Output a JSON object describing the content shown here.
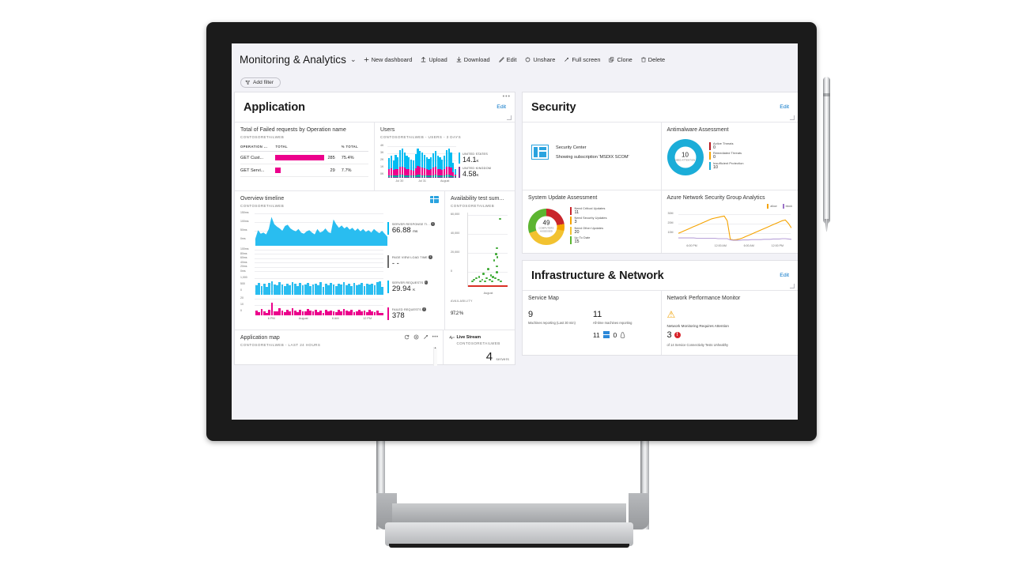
{
  "toolbar": {
    "dashboard_title": "Monitoring & Analytics",
    "chevron": "⌄",
    "commands": [
      {
        "label": "New dashboard",
        "icon": "plus-icon"
      },
      {
        "label": "Upload",
        "icon": "upload-icon"
      },
      {
        "label": "Download",
        "icon": "download-icon"
      },
      {
        "label": "Edit",
        "icon": "pencil-icon"
      },
      {
        "label": "Unshare",
        "icon": "unshare-icon"
      },
      {
        "label": "Full screen",
        "icon": "fullscreen-icon"
      },
      {
        "label": "Clone",
        "icon": "clone-icon"
      },
      {
        "label": "Delete",
        "icon": "trash-icon"
      }
    ],
    "add_filter": "Add filter"
  },
  "panels": {
    "application": {
      "title": "Application",
      "edit": "Edit"
    },
    "security": {
      "title": "Security",
      "edit": "Edit"
    },
    "infrastructure": {
      "title": "Infrastructure & Network",
      "edit": "Edit"
    }
  },
  "failed_requests": {
    "title": "Total of Failed requests by Operation name",
    "subtitle": "CONTOSORETAILWEB",
    "columns": [
      "OPERATION ...",
      "TOTAL",
      "% TOTAL"
    ],
    "rows": [
      {
        "operation": "GET Cust...",
        "total": "285",
        "pct": "75.4%",
        "bar": 100
      },
      {
        "operation": "GET Servi...",
        "total": "29",
        "pct": "7.7%",
        "bar": 10
      }
    ]
  },
  "users": {
    "title": "Users",
    "subtitle": "CONTOSORETAILWEB - USERS - 3 DAYS",
    "y_ticks": [
      "4K",
      "3K",
      "2K",
      "1K",
      "0K"
    ],
    "x_ticks": [
      "Jul 30",
      "Jul 31",
      "August"
    ],
    "legend": [
      {
        "name": "UNITED STATES",
        "value": "14.1",
        "unit": "K",
        "color": "#00bcf2"
      },
      {
        "name": "UNITED KINGDOM",
        "value": "4.58",
        "unit": "K",
        "color": "#7a3b9a"
      }
    ],
    "bars": [
      [
        42,
        22,
        6,
        4
      ],
      [
        48,
        26,
        6,
        4
      ],
      [
        36,
        20,
        5,
        4
      ],
      [
        52,
        24,
        6,
        4
      ],
      [
        44,
        22,
        6,
        4
      ],
      [
        62,
        30,
        7,
        4
      ],
      [
        66,
        32,
        7,
        4
      ],
      [
        58,
        28,
        6,
        4
      ],
      [
        48,
        24,
        6,
        4
      ],
      [
        44,
        22,
        6,
        4
      ],
      [
        40,
        20,
        5,
        4
      ],
      [
        38,
        18,
        5,
        4
      ],
      [
        52,
        26,
        6,
        4
      ],
      [
        64,
        34,
        7,
        4
      ],
      [
        60,
        30,
        7,
        4
      ],
      [
        56,
        28,
        6,
        4
      ],
      [
        50,
        26,
        6,
        4
      ],
      [
        46,
        22,
        6,
        4
      ],
      [
        42,
        20,
        5,
        4
      ],
      [
        46,
        22,
        6,
        4
      ],
      [
        54,
        28,
        6,
        4
      ],
      [
        58,
        30,
        7,
        4
      ],
      [
        50,
        24,
        6,
        4
      ],
      [
        44,
        22,
        6,
        4
      ],
      [
        40,
        20,
        5,
        4
      ],
      [
        48,
        24,
        6,
        4
      ],
      [
        62,
        30,
        7,
        4
      ],
      [
        66,
        32,
        7,
        4
      ],
      [
        58,
        28,
        6,
        4
      ],
      [
        36,
        14,
        4,
        3
      ],
      [
        20,
        8,
        3,
        2
      ]
    ]
  },
  "overview_timeline": {
    "title": "Overview timeline",
    "subtitle": "CONTOSORETAILWEB",
    "icon": "chart-grid-icon",
    "chart1_y": [
      "150ms",
      "100ms",
      "50ms",
      "0ms"
    ],
    "chart2_y": [
      "100ms",
      "80ms",
      "60ms",
      "40ms",
      "20ms",
      "0ms"
    ],
    "chart3_y": [
      "1,000",
      "500",
      "0"
    ],
    "chart4_y": [
      "20",
      "10",
      "0"
    ],
    "x_ticks": [
      "6 PM",
      "August",
      "6 AM",
      "12 PM"
    ],
    "metrics": [
      {
        "name": "SERVER RESPONSE TI...",
        "value": "66.88",
        "unit": "ms",
        "color": "#00bcf2"
      },
      {
        "name": "PAGE VIEW LOAD TIME",
        "value": "- -",
        "unit": "",
        "color": "#6b6b6b"
      },
      {
        "name": "SERVER REQUESTS",
        "value": "29.94",
        "unit": "K",
        "color": "#00bcf2"
      },
      {
        "name": "FAILED REQUESTS",
        "value": "378",
        "unit": "",
        "color": "#ec008c"
      }
    ],
    "area_points": [
      24,
      52,
      40,
      44,
      38,
      56,
      96,
      72,
      64,
      58,
      50,
      66,
      70,
      58,
      52,
      48,
      56,
      44,
      40,
      48,
      52,
      44,
      38,
      56,
      44,
      48,
      58,
      46,
      42,
      88,
      72,
      60,
      68,
      58,
      64,
      54,
      60,
      50,
      58,
      48,
      56,
      46,
      52,
      44,
      56,
      48,
      42,
      50,
      40,
      30
    ],
    "req_bars": [
      52,
      64,
      48,
      58,
      44,
      62,
      70,
      56,
      50,
      66,
      54,
      48,
      60,
      52,
      68,
      58,
      46,
      62,
      50,
      56,
      64,
      48,
      54,
      60,
      52,
      66,
      44,
      58,
      50,
      62,
      56,
      48,
      60,
      54,
      66,
      52,
      58,
      46,
      62,
      50,
      56,
      64,
      48,
      60,
      54,
      58,
      52,
      66,
      70,
      44
    ],
    "fail_bars": [
      30,
      22,
      40,
      26,
      18,
      34,
      82,
      28,
      24,
      46,
      30,
      22,
      38,
      26,
      44,
      30,
      20,
      36,
      28,
      24,
      40,
      32,
      26,
      34,
      22,
      30,
      18,
      38,
      26,
      32,
      28,
      20,
      36,
      24,
      42,
      30,
      26,
      34,
      22,
      28,
      36,
      24,
      30,
      20,
      34,
      26,
      22,
      30,
      18,
      14
    ]
  },
  "availability": {
    "title": "Availability test sum...",
    "subtitle": "CONTOSORETAILWEB",
    "y_ticks": [
      "60,000",
      "40,000",
      "20,000",
      "0"
    ],
    "x_tick": "August",
    "kpi_label": "AVAILABILITY",
    "kpi_value": "97.2",
    "kpi_unit": "%",
    "scatter": [
      {
        "x": 78,
        "y": 7
      },
      {
        "x": 70,
        "y": 46
      },
      {
        "x": 71,
        "y": 58
      },
      {
        "x": 68,
        "y": 54
      },
      {
        "x": 63,
        "y": 62
      },
      {
        "x": 70,
        "y": 70
      },
      {
        "x": 48,
        "y": 74
      },
      {
        "x": 70,
        "y": 78
      },
      {
        "x": 36,
        "y": 80
      },
      {
        "x": 55,
        "y": 82
      },
      {
        "x": 60,
        "y": 84
      },
      {
        "x": 25,
        "y": 84
      },
      {
        "x": 44,
        "y": 86
      },
      {
        "x": 18,
        "y": 86
      },
      {
        "x": 33,
        "y": 88
      },
      {
        "x": 52,
        "y": 88
      },
      {
        "x": 66,
        "y": 86
      },
      {
        "x": 74,
        "y": 88
      },
      {
        "x": 12,
        "y": 88
      },
      {
        "x": 28,
        "y": 90
      },
      {
        "x": 40,
        "y": 90
      },
      {
        "x": 58,
        "y": 90
      },
      {
        "x": 80,
        "y": 90
      },
      {
        "x": 8,
        "y": 90
      }
    ]
  },
  "application_map": {
    "title": "Application map",
    "subtitle": "CONTOSORETAILWEB - LAST 24 HOURS",
    "icons": [
      "refresh-icon",
      "target-icon",
      "expand-icon",
      "more-icon"
    ]
  },
  "live_stream": {
    "title": "Live Stream",
    "subtitle": "CONTOSORETAILWEB",
    "value": "4",
    "unit": "servers",
    "icon": "pulse-icon"
  },
  "security_center": {
    "name": "Security Center",
    "subscription": "Showing subscription 'MSDIX SCOM'",
    "icon": "security-center-icon"
  },
  "antimalware": {
    "title": "Antimalware Assessment",
    "center_value": "10",
    "center_label": "NEED ATTENTION",
    "donut_color": "#1badd8",
    "legend": [
      {
        "name": "Active Threats",
        "value": "0",
        "color": "#b81b21"
      },
      {
        "name": "Remediated Threats",
        "value": "0",
        "color": "#f5a300"
      },
      {
        "name": "Insufficient Protection",
        "value": "10",
        "color": "#1badd8"
      }
    ]
  },
  "system_update": {
    "title": "System Update Assessment",
    "center_value": "49",
    "center_label": "COMPUTERS ASSESSED",
    "legend": [
      {
        "name": "Need Critical Updates",
        "value": "11",
        "color": "#c9252b"
      },
      {
        "name": "Need Security Updates",
        "value": "3",
        "color": "#f5a300"
      },
      {
        "name": "Need Other Updates",
        "value": "20",
        "color": "#f2c230"
      },
      {
        "name": "Up To Date",
        "value": "15",
        "color": "#5cb531"
      }
    ]
  },
  "nsg_analytics": {
    "title": "Azure Network Security Group Analytics",
    "legend": [
      {
        "name": "allow",
        "color": "#f5a300"
      },
      {
        "name": "block",
        "color": "#9b72c7"
      }
    ],
    "y_ticks": [
      "30M",
      "20M",
      "10M"
    ],
    "x_ticks": [
      "6:00 PM",
      "12:00 AM",
      "6:00 AM",
      "12:00 PM"
    ],
    "allow_series": [
      28,
      32,
      36,
      40,
      44,
      48,
      52,
      56,
      60,
      64,
      68,
      72,
      74,
      76,
      78,
      80,
      66,
      10,
      8,
      9,
      11,
      14,
      18,
      22,
      26,
      30,
      34,
      38,
      42,
      46,
      50,
      54,
      58,
      62,
      66,
      68,
      58,
      44
    ],
    "block_series": [
      14,
      14,
      14,
      14,
      14,
      14,
      13,
      13,
      13,
      13,
      13,
      13,
      13,
      12,
      12,
      12,
      12,
      8,
      7,
      7,
      7,
      8,
      8,
      8,
      9,
      9,
      9,
      9,
      10,
      10,
      10,
      11,
      11,
      11,
      12,
      12,
      11,
      10
    ]
  },
  "service_map": {
    "title": "Service Map",
    "reporting_num": "9",
    "reporting_label": "Machines reporting (Last 30 min)",
    "alltime_num": "11",
    "alltime_label": "All-time machines reporting",
    "windows_count": "11",
    "linux_count": "0"
  },
  "network_performance": {
    "title": "Network Performance Monitor",
    "warning_icon": "warning-triangle-icon",
    "message": "Network Monitoring Requires Attention",
    "count": "3",
    "badge_icon": "error-badge-icon",
    "detail": "of 14 Service Connectivity Tests Unhealthy"
  }
}
